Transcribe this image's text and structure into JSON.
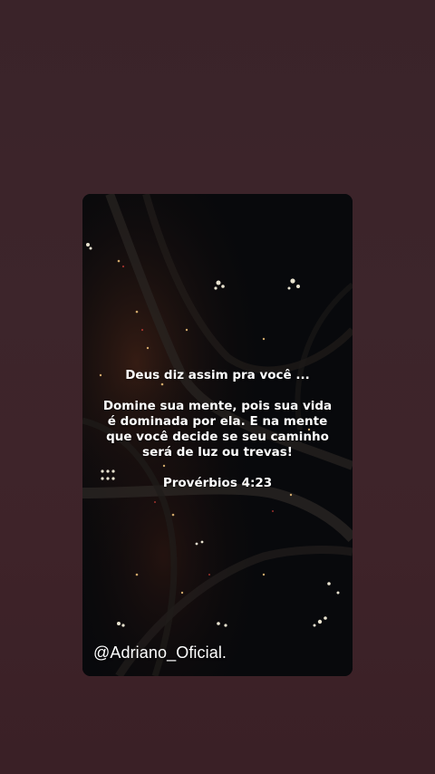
{
  "story": {
    "intro": "Deus diz assim pra você ...",
    "body_lines": [
      "Domine sua mente, pois sua vida",
      "é dominada por ela. E na mente",
      "que você decide se seu caminho",
      "será de luz ou trevas!"
    ],
    "reference": "Provérbios 4:23",
    "author_handle": "@Adriano_Oficial."
  },
  "colors": {
    "page_background": "#3d252b",
    "card_background": "#07080b",
    "text": "#ffffff"
  }
}
